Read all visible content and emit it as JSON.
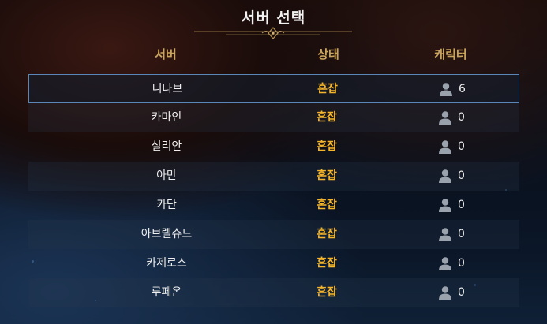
{
  "dialog": {
    "title": "서버 선택"
  },
  "columns": {
    "server": "서버",
    "status": "상태",
    "characters": "캐릭터"
  },
  "icons": {
    "character": "person-icon"
  },
  "colors": {
    "header": "#c9a45c",
    "status": "#f5b52a",
    "selection_border": "#5a86b8"
  },
  "servers": [
    {
      "name": "니나브",
      "status": "혼잡",
      "characters": "6",
      "selected": true
    },
    {
      "name": "카마인",
      "status": "혼잡",
      "characters": "0"
    },
    {
      "name": "실리안",
      "status": "혼잡",
      "characters": "0"
    },
    {
      "name": "아만",
      "status": "혼잡",
      "characters": "0"
    },
    {
      "name": "카단",
      "status": "혼잡",
      "characters": "0"
    },
    {
      "name": "아브렐슈드",
      "status": "혼잡",
      "characters": "0"
    },
    {
      "name": "카제로스",
      "status": "혼잡",
      "characters": "0"
    },
    {
      "name": "루페온",
      "status": "혼잡",
      "characters": "0"
    }
  ]
}
